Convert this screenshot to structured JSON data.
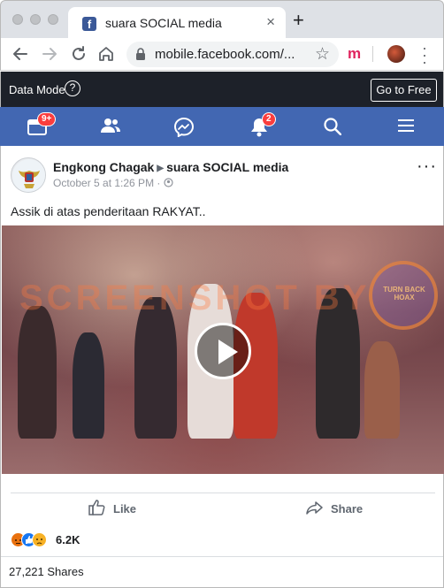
{
  "browser": {
    "tab_title": "suara SOCIAL media",
    "tab_favicon": "f",
    "url": "mobile.facebook.com/...",
    "extension_letter": "m"
  },
  "data_mode": {
    "label": "Data Mode",
    "help_symbol": "?",
    "go_free": "Go to Free"
  },
  "fb_nav": {
    "home_badge": "9+",
    "notifications_badge": "2",
    "icons": [
      "news-feed-icon",
      "friends-icon",
      "messenger-icon",
      "notifications-icon",
      "search-icon",
      "menu-icon"
    ]
  },
  "post": {
    "author": "Engkong Chagak",
    "group": "suara SOCIAL media",
    "timestamp": "October 5 at 1:26 PM",
    "privacy_separator": "·",
    "text": "Assik di atas penderitaan RAKYAT..",
    "video": {
      "watermark": "SCREENSHOT BY",
      "stamp_text": "TURN BACK HOAX"
    },
    "actions": {
      "like": "Like",
      "share": "Share"
    },
    "reactions": {
      "count": "6.2K",
      "types": [
        "angry",
        "like",
        "sad"
      ]
    },
    "shares": "27,221 Shares"
  },
  "colors": {
    "fb_blue": "#4267b2",
    "data_mode_bar": "#1d2129",
    "badge_red": "#fa3e3e"
  }
}
